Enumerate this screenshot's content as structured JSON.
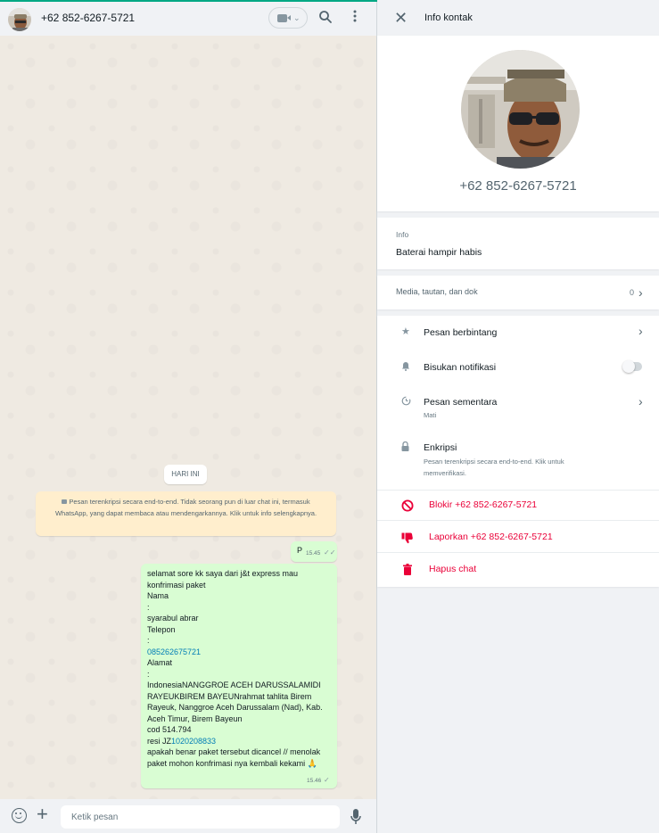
{
  "chat": {
    "contact_name": "+62 852-6267-5721",
    "video_chevron": "⌄",
    "date_pill": "HARI INI",
    "encryption_notice": "Pesan terenkripsi secara end-to-end. Tidak seorang pun di luar chat ini, termasuk WhatsApp, yang dapat membaca atau mendengarkannya. Klik untuk info selengkapnya.",
    "messages": [
      {
        "text": "P",
        "time": "15.45",
        "ticks": "✓✓"
      },
      {
        "lines": [
          "selamat sore kk saya dari j&t express mau",
          "konfrimasi paket",
          "Nama",
          ":",
          "syarabul abrar",
          "Telepon",
          ":",
          "085262675721",
          "Alamat",
          ":",
          "IndonesiaNANGGROE ACEH DARUSSALAMIDI",
          "RAYEUKBIREM BAYEUNrahmat tahlita Birem",
          "Rayeuk, Nanggroe Aceh Darussalam (Nad), Kab.",
          "Aceh Timur, Birem Bayeun",
          "cod 514.794",
          "apakah benar paket tersebut  dicancel // menolak",
          "paket mohon konfrimasi nya kembali kekami 🙏"
        ],
        "resi_prefix": "resi JZ",
        "resi_link": "1020208833",
        "time": "15.46",
        "ticks": "✓"
      }
    ],
    "composer_placeholder": "Ketik pesan"
  },
  "panel": {
    "title": "Info kontak",
    "phone": "+62 852-6267-5721",
    "about_label": "Info",
    "about_text": "Baterai hampir habis",
    "media_label": "Media, tautan, dan dok",
    "media_count": "0",
    "starred_label": "Pesan berbintang",
    "mute_label": "Bisukan notifikasi",
    "disappearing_label": "Pesan sementara",
    "disappearing_value": "Mati",
    "encryption_label": "Enkripsi",
    "encryption_sub_1": "Pesan terenkripsi secara end-to-end. Klik untuk",
    "encryption_sub_2": "memverifikasi.",
    "block_label": "Blokir +62 852-6267-5721",
    "report_label": "Laporkan +62 852-6267-5721",
    "delete_label": "Hapus chat"
  },
  "colors": {
    "accent": "#00a884",
    "outgoing_bubble": "#d9fdd3",
    "notice_bg": "#ffeecd",
    "danger": "#ea0038",
    "link": "#027eb5"
  }
}
